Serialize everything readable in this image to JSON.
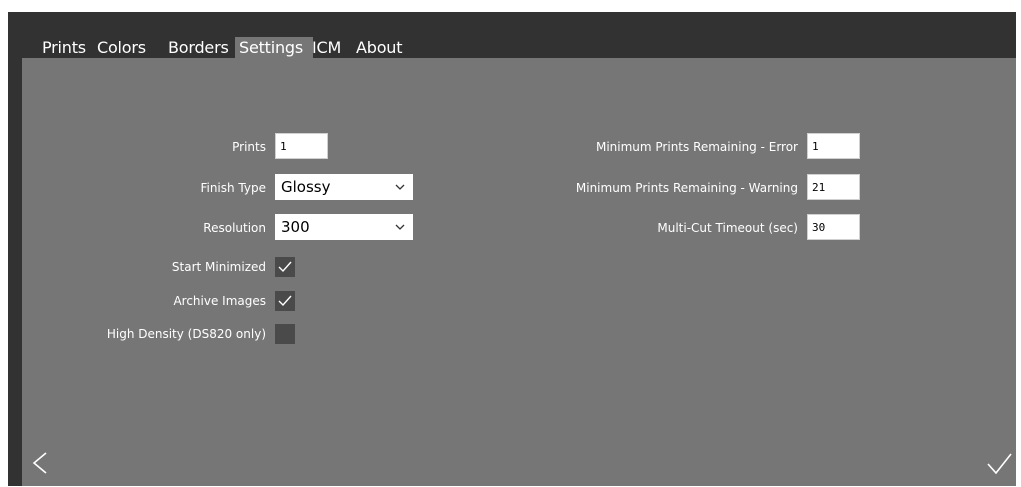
{
  "tabs": [
    {
      "label": "Prints"
    },
    {
      "label": "Colors"
    },
    {
      "label": "Borders"
    },
    {
      "label": "Settings"
    },
    {
      "label": "ICM"
    },
    {
      "label": "About"
    }
  ],
  "active_tab": "Settings",
  "left": {
    "prints_label": "Prints",
    "prints_value": "1",
    "finish_type_label": "Finish Type",
    "finish_type_value": "Glossy",
    "resolution_label": "Resolution",
    "resolution_value": "300",
    "start_minimized_label": "Start Minimized",
    "start_minimized_checked": true,
    "archive_images_label": "Archive Images",
    "archive_images_checked": true,
    "high_density_label": "High Density (DS820 only)",
    "high_density_checked": false
  },
  "right": {
    "min_error_label": "Minimum Prints Remaining - Error",
    "min_error_value": "1",
    "min_warning_label": "Minimum Prints Remaining - Warning",
    "min_warning_value": "21",
    "multicut_label": "Multi-Cut Timeout (sec)",
    "multicut_value": "30"
  },
  "icons": {
    "back": "chevron-left-icon",
    "confirm": "checkmark-icon",
    "dropdown": "chevron-down-icon"
  },
  "colors": {
    "frame": "#323232",
    "panel": "#767676",
    "checkbox": "#4a4a4a",
    "text": "#ffffff"
  }
}
